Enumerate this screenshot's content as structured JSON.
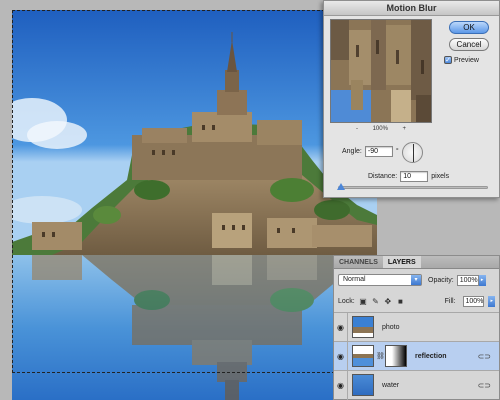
{
  "dialog": {
    "title": "Motion Blur",
    "ok_label": "OK",
    "cancel_label": "Cancel",
    "preview_label": "Preview",
    "preview_checked": true,
    "zoom_out": "-",
    "zoom_level": "100%",
    "zoom_in": "+",
    "angle_label": "Angle:",
    "angle_value": "-90",
    "degree_symbol": "°",
    "distance_label": "Distance:",
    "distance_value": "10",
    "distance_unit": "pixels",
    "distance_slider_fraction": 0.02
  },
  "panel": {
    "tabs": [
      {
        "label": "CHANNELS",
        "active": false
      },
      {
        "label": "LAYERS",
        "active": true
      }
    ],
    "blend_mode": "Normal",
    "opacity_label": "Opacity:",
    "opacity_value": "100%",
    "lock_label": "Lock:",
    "fill_label": "Fill:",
    "fill_value": "100%",
    "layers": [
      {
        "name": "photo",
        "visible": true,
        "selected": false
      },
      {
        "name": "reflection",
        "visible": true,
        "selected": true,
        "has_mask": true
      },
      {
        "name": "water",
        "visible": true,
        "selected": false
      }
    ]
  },
  "icons": {
    "eye": "eye-icon",
    "chain": "chain-link-icon",
    "fx": "layer-link-icon",
    "lock_transparency": "lock-transparency-icon",
    "lock_paint": "brush-icon",
    "lock_move": "move-icon",
    "lock_all": "lock-icon"
  },
  "colors": {
    "sky": "#2f79cf",
    "ok_button": "#5c98e8",
    "selected_layer": "#b8cff0"
  }
}
